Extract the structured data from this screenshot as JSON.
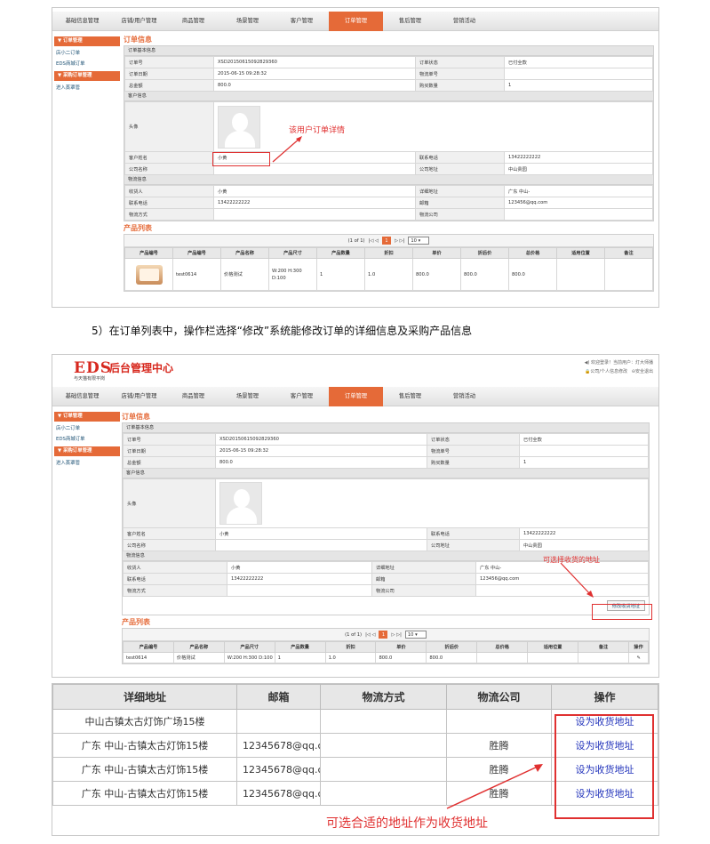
{
  "nav": [
    "基础信息管理",
    "店铺/用户管理",
    "商品管理",
    "场景管理",
    "客户管理",
    "订单管理",
    "售后管理",
    "营销活动"
  ],
  "sidebar": {
    "head1": "▼ 订单管理",
    "items1": [
      "店小二订单",
      "EDS商城订单"
    ],
    "head2": "▼ 采购订单管理",
    "items2": [
      "进入蒸罩管"
    ]
  },
  "order": {
    "title": "订单信息",
    "basic_bar": "订单基本信息",
    "order_no_label": "订单号",
    "order_no": "XSD20150615092829360",
    "status_label": "订单状态",
    "status": "已付全款",
    "date_label": "订单日期",
    "date": "2015-06-15 09:28:32",
    "logistics_no_label": "物流单号",
    "total_label": "总金额",
    "total": "800.0",
    "qty_label": "购买数量",
    "qty": "1",
    "customer_bar": "客户信息",
    "avatar_label": "头像",
    "name_label": "客户姓名",
    "name": "小黄",
    "phone_label": "联系电话",
    "phone": "13422222222",
    "company_label": "公司名称",
    "company_addr_label": "公司地址",
    "company_addr": "中山贵园",
    "logistics_bar": "物流信息",
    "receiver_label": "收货人",
    "receiver": "小黄",
    "detail_addr_label": "详细地址",
    "detail_addr": "广东 中山-",
    "contact_label": "联系电话",
    "contact": "13422222222",
    "email_label": "邮箱",
    "email": "123456@qq.com",
    "method_label": "物流方式",
    "company2_label": "物流公司"
  },
  "products": {
    "title": "产品列表",
    "page_info": "(1 of 1)",
    "page_prev": "|◁  ◁",
    "page_cur": "1",
    "page_next": "▷  ▷|",
    "page_size": "10 ▾",
    "headers1": [
      "产品编号",
      "产品编号",
      "产品名称",
      "产品尺寸",
      "产品数量",
      "折扣",
      "单价",
      "折后价",
      "总价格",
      "适用位置",
      "备注"
    ],
    "row1": [
      "",
      "test0614",
      "价格测试",
      "W:200 H:300 D:100",
      "1",
      "1.0",
      "800.0",
      "800.0",
      "800.0",
      "",
      ""
    ],
    "headers2": [
      "产品编号",
      "产品名称",
      "产品尺寸",
      "产品数量",
      "折扣",
      "单价",
      "折后价",
      "总价格",
      "适用位置",
      "备注",
      "操作"
    ],
    "row2": [
      "test0614",
      "价格测试",
      "W:200 H:300 D:100",
      "1",
      "1.0",
      "800.0",
      "800.0",
      "",
      "",
      "",
      "✎"
    ]
  },
  "annotations": {
    "user_detail": "该用户订单详情",
    "choose_addr": "可选择收货的地址",
    "choose_suitable": "可选合适的地址作为收货地址"
  },
  "caption": "5）在订单列表中，操作栏选择“修改”系统能修改订单的详细信息及采购产品信息",
  "header2": {
    "logo": "EDS",
    "logo_sub": "与天猫有限平岗",
    "title": "后台管理中心",
    "top_line1": "◀) 欢迎登录！当前用户：灯大师播",
    "top_link1": "🔒公司/个人信息修改",
    "top_link2": "⊖安全退出"
  },
  "modify_addr_btn": "修改收货地址",
  "address_table": {
    "headers": [
      "详细地址",
      "邮箱",
      "物流方式",
      "物流公司",
      "操作"
    ],
    "rows": [
      {
        "addr": "中山古镇太古灯饰广场15楼",
        "email": "",
        "method": "",
        "company": "",
        "action": "设为收货地址"
      },
      {
        "addr": "广东 中山-古镇太古灯饰15楼",
        "email": "12345678@qq.c",
        "method": "",
        "company": "胜腾",
        "action": "设为收货地址"
      },
      {
        "addr": "广东 中山-古镇太古灯饰15楼",
        "email": "12345678@qq.c",
        "method": "",
        "company": "胜腾",
        "action": "设为收货地址"
      },
      {
        "addr": "广东 中山-古镇太古灯饰15楼",
        "email": "12345678@qq.c",
        "method": "",
        "company": "胜腾",
        "action": "设为收货地址"
      }
    ]
  }
}
